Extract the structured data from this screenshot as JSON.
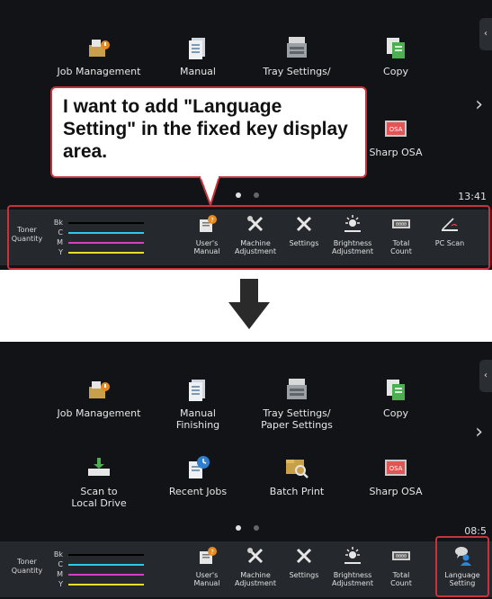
{
  "top": {
    "apps": [
      {
        "label": "Job Management",
        "icon": "job-management-icon"
      },
      {
        "label": "Manual",
        "icon": "manual-icon"
      },
      {
        "label": "Tray Settings/",
        "icon": "tray-settings-icon"
      },
      {
        "label": "Copy",
        "icon": "copy-icon"
      },
      {
        "label": "Sharp OSA",
        "icon": "sharp-osa-icon"
      }
    ],
    "callout": "I want to add \"Language Setting\" in the fixed key display area.",
    "clock": "13:41"
  },
  "bottom": {
    "apps": [
      {
        "label": "Job Management",
        "icon": "job-management-icon"
      },
      {
        "label": "Manual\nFinishing",
        "icon": "manual-finishing-icon"
      },
      {
        "label": "Tray Settings/\nPaper Settings",
        "icon": "tray-settings-icon"
      },
      {
        "label": "Copy",
        "icon": "copy-icon"
      },
      {
        "label": "Scan to\nLocal Drive",
        "icon": "scan-to-local-drive-icon"
      },
      {
        "label": "Recent Jobs",
        "icon": "recent-jobs-icon"
      },
      {
        "label": "Batch Print",
        "icon": "batch-print-icon"
      },
      {
        "label": "Sharp OSA",
        "icon": "sharp-osa-icon"
      }
    ],
    "clock": "08:5"
  },
  "toner": {
    "title": "Toner\nQuantity",
    "rows": [
      {
        "code": "Bk",
        "color": "#000000"
      },
      {
        "code": "C",
        "color": "#2ec9e8"
      },
      {
        "code": "M",
        "color": "#d43fc4"
      },
      {
        "code": "Y",
        "color": "#e5de2a"
      }
    ]
  },
  "fixed_keys_top": [
    {
      "label": "User's\nManual",
      "icon": "users-manual-icon"
    },
    {
      "label": "Machine\nAdjustment",
      "icon": "machine-adjustment-icon"
    },
    {
      "label": "Settings",
      "icon": "settings-icon"
    },
    {
      "label": "Brightness\nAdjustment",
      "icon": "brightness-icon"
    },
    {
      "label": "Total\nCount",
      "icon": "total-count-icon"
    },
    {
      "label": "PC Scan",
      "icon": "pc-scan-icon"
    }
  ],
  "fixed_keys_bottom": [
    {
      "label": "User's\nManual",
      "icon": "users-manual-icon"
    },
    {
      "label": "Machine\nAdjustment",
      "icon": "machine-adjustment-icon"
    },
    {
      "label": "Settings",
      "icon": "settings-icon"
    },
    {
      "label": "Brightness\nAdjustment",
      "icon": "brightness-icon"
    },
    {
      "label": "Total\nCount",
      "icon": "total-count-icon"
    },
    {
      "label": "Language\nSetting",
      "icon": "language-setting-icon"
    }
  ],
  "colors": {
    "highlight": "#c8323c",
    "panel_bg": "#111316",
    "fixed_bar_bg": "#25282c",
    "arrow": "#2a2a2a"
  }
}
